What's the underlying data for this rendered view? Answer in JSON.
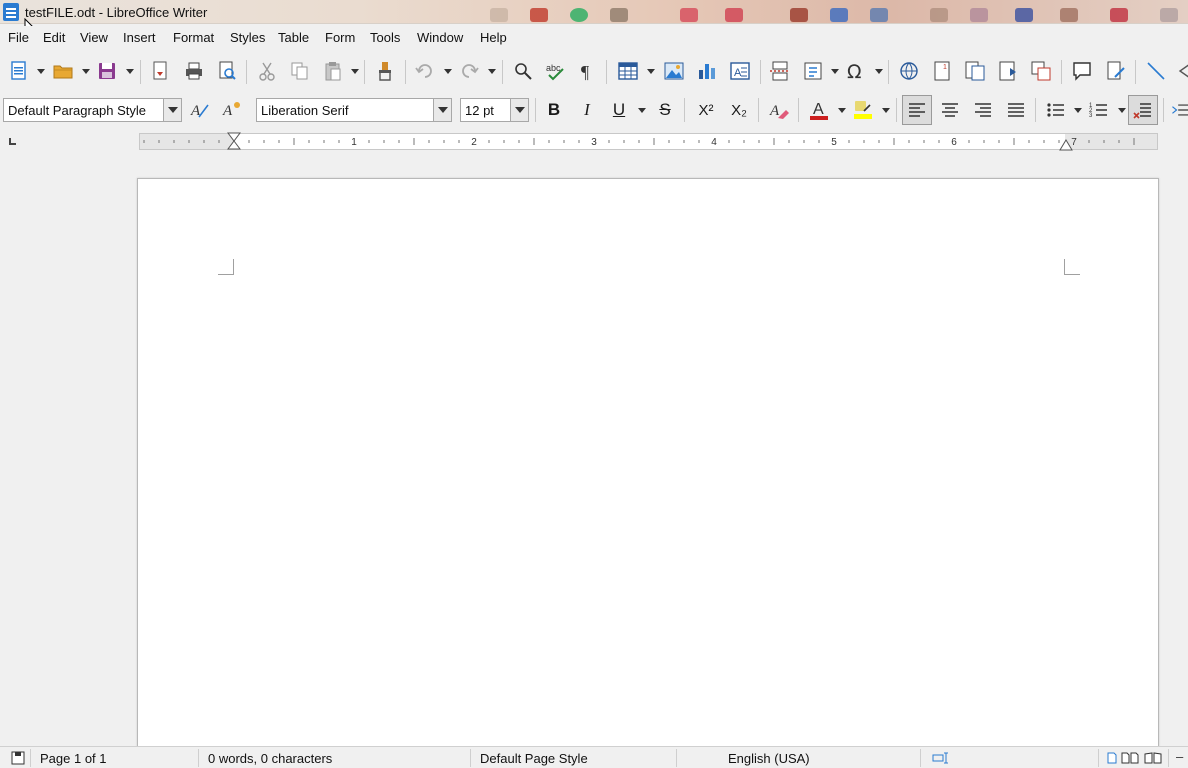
{
  "window": {
    "title": "testFILE.odt - LibreOffice Writer"
  },
  "menu": {
    "items": [
      "File",
      "Edit",
      "View",
      "Insert",
      "Format",
      "Styles",
      "Table",
      "Form",
      "Tools",
      "Window",
      "Help"
    ]
  },
  "formatting": {
    "paragraph_style": "Default Paragraph Style",
    "font_name": "Liberation Serif",
    "font_size": "12 pt",
    "bold_label": "B",
    "italic_label": "I",
    "underline_label": "U",
    "strikethrough_label": "S",
    "superscript_label": "X²",
    "subscript_label": "X₂",
    "font_color": "#cc1f1f",
    "highlight_color": "#ffff00"
  },
  "ruler": {
    "labels": [
      "1",
      "2",
      "3",
      "4",
      "5",
      "6",
      "7"
    ]
  },
  "status": {
    "page": "Page 1 of 1",
    "words": "0 words, 0 characters",
    "page_style": "Default Page Style",
    "language": "English (USA)"
  },
  "colors": {
    "accent": "#2a7bd1",
    "active_button_bg": "#dcdcdc"
  }
}
